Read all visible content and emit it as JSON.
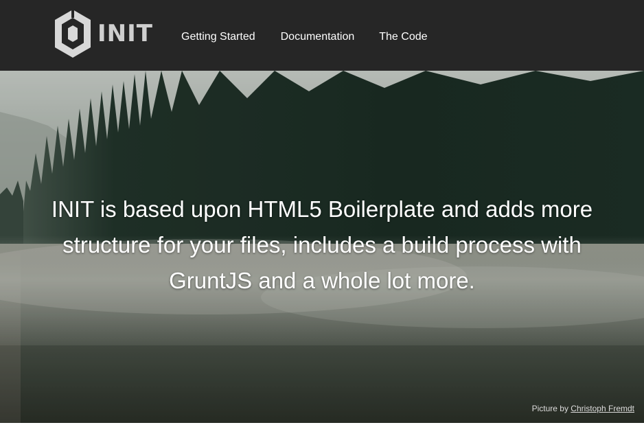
{
  "brand": {
    "name": "INIT",
    "logo_icon": "init-hexagon-logo-icon"
  },
  "nav": {
    "items": [
      {
        "label": "Getting Started"
      },
      {
        "label": "Documentation"
      },
      {
        "label": "The Code"
      }
    ]
  },
  "hero": {
    "headline": "INIT is based upon HTML5 Boilerplate and adds more structure for your files, includes a build process with GruntJS and a whole lot more.",
    "credit_prefix": "Picture by",
    "credit_author": "Christoph Fremdt"
  },
  "colors": {
    "header_bg": "#262626",
    "nav_text": "#ffffff",
    "logo": "#cfcfcf"
  }
}
